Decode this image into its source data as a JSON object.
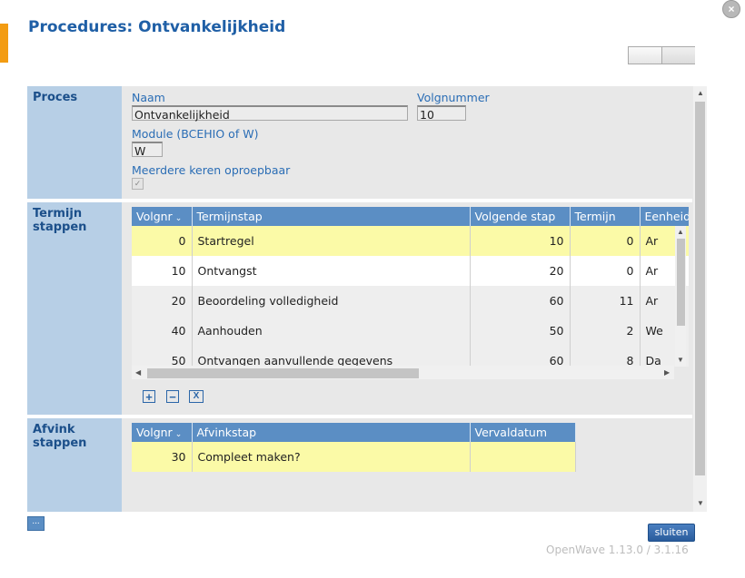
{
  "dialog": {
    "title": "Procedures: Ontvankelijkheid",
    "close_icon": "×"
  },
  "proces": {
    "label": "Proces",
    "naam_label": "Naam",
    "naam_value": "Ontvankelijkheid",
    "volgnummer_label": "Volgnummer",
    "volgnummer_value": "10",
    "module_label": "Module (BCEHIO of W)",
    "module_value": "W",
    "meerdere_label": "Meerdere keren oproepbaar",
    "meerdere_checked": true
  },
  "termijn": {
    "label_line1": "Termijn",
    "label_line2": "stappen",
    "columns": [
      "Volgnr",
      "Termijnstap",
      "Volgende stap",
      "Termijn",
      "Eenheid"
    ],
    "sort_icon": "⌄",
    "rows": [
      {
        "volgnr": "0",
        "stap": "Startregel",
        "volgende": "10",
        "termijn": "0",
        "eenheid": "Ar"
      },
      {
        "volgnr": "10",
        "stap": "Ontvangst",
        "volgende": "20",
        "termijn": "0",
        "eenheid": "Ar"
      },
      {
        "volgnr": "20",
        "stap": "Beoordeling volledigheid",
        "volgende": "60",
        "termijn": "11",
        "eenheid": "Ar"
      },
      {
        "volgnr": "40",
        "stap": "Aanhouden",
        "volgende": "50",
        "termijn": "2",
        "eenheid": "We"
      },
      {
        "volgnr": "50",
        "stap": "Ontvangen aanvullende gegevens",
        "volgende": "60",
        "termijn": "8",
        "eenheid": "Da"
      }
    ],
    "tools": {
      "add": "+",
      "remove": "−",
      "excel": "X"
    }
  },
  "afvink": {
    "label_line1": "Afvink",
    "label_line2": "stappen",
    "columns": [
      "Volgnr",
      "Afvinkstap",
      "Vervaldatum"
    ],
    "rows": [
      {
        "volgnr": "30",
        "stap": "Compleet maken?",
        "vervaldatum": ""
      }
    ]
  },
  "footer": {
    "more_label": "...",
    "sluiten_label": "sluiten",
    "version": "OpenWave 1.13.0 / 3.1.16"
  },
  "colors": {
    "accent": "#f39c12",
    "title": "#1f5fa6",
    "header": "#5b8ec4",
    "highlight_row": "#fbfaa7",
    "section_label": "#b7cfe6"
  }
}
